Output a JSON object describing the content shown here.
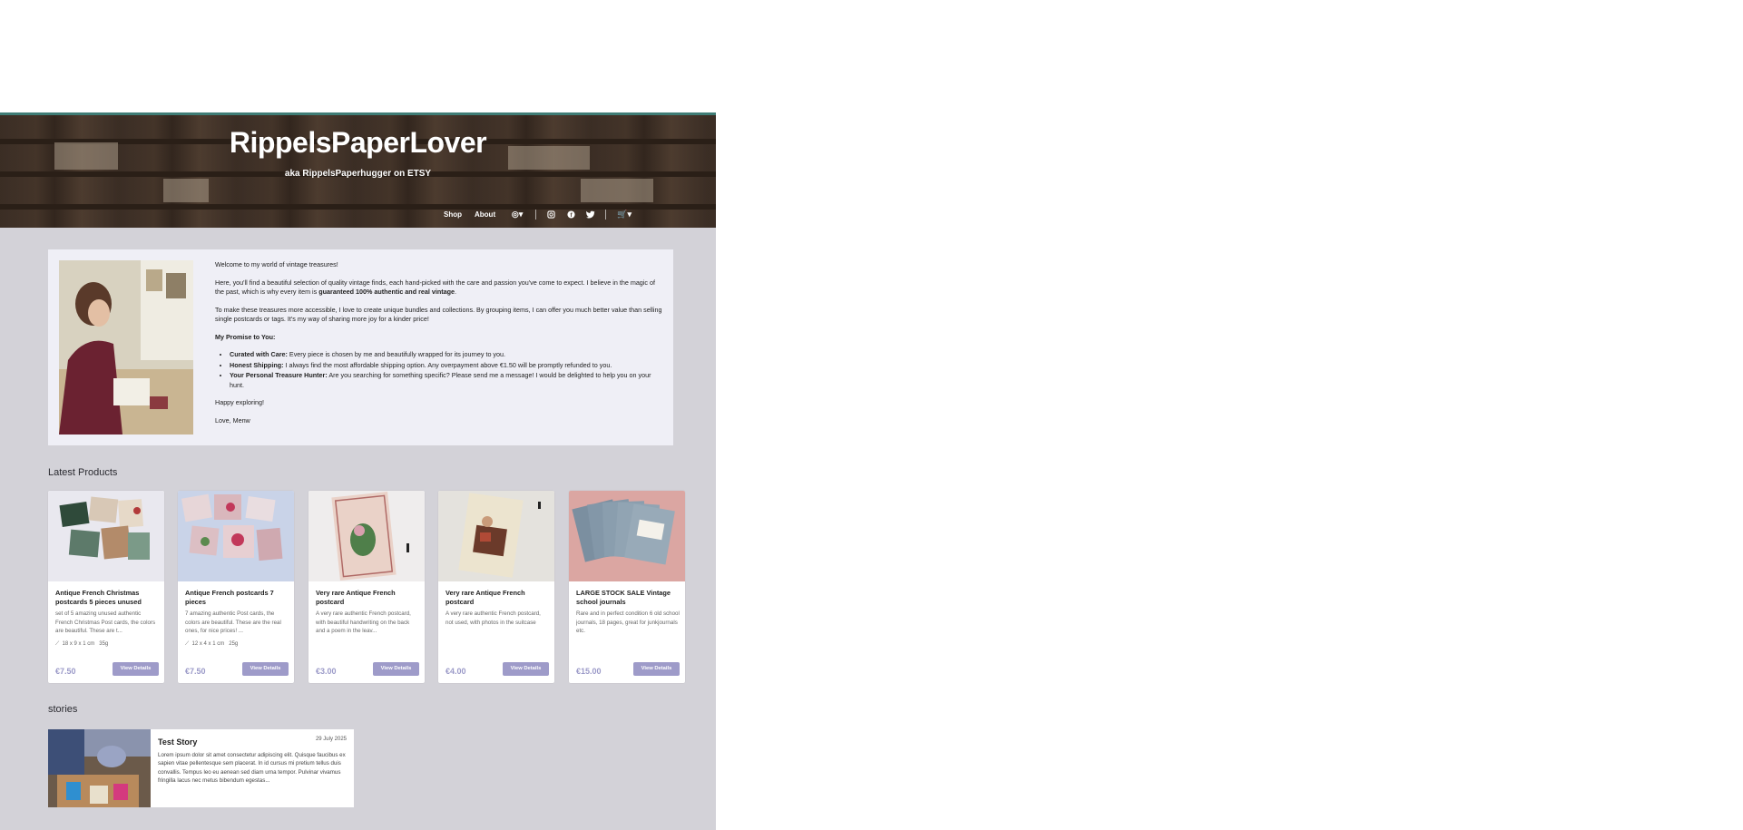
{
  "header": {
    "title": "RippelsPaperLover",
    "subtitle": "aka RippelsPaperhugger on ETSY",
    "nav": {
      "shop": "Shop",
      "about": "About"
    },
    "icons": [
      "language-icon",
      "instagram-icon",
      "facebook-icon",
      "twitter-icon",
      "cart-icon"
    ]
  },
  "intro": {
    "welcome": "Welcome to my world of vintage treasures!",
    "para1_a": "Here, you'll find a beautiful selection of quality vintage finds, each hand-picked with the care and passion you've come to expect. I believe in the magic of the past, which is why every item is ",
    "para1_bold": "guaranteed 100% authentic and real vintage",
    "para1_end": ".",
    "para2": "To make these treasures more accessible, I love to create unique bundles and collections. By grouping items, I can offer you much better value than selling single postcards or tags. It's my way of sharing more joy for a kinder price!",
    "promise_title": "My Promise to You:",
    "promises": [
      {
        "label": "Curated with Care:",
        "text": " Every piece is chosen by me and beautifully wrapped for its journey to you."
      },
      {
        "label": "Honest Shipping:",
        "text": " I always find the most affordable shipping option. Any overpayment above €1.50 will be promptly refunded to you."
      },
      {
        "label": "Your Personal Treasure Hunter:",
        "text": " Are you searching for something specific? Please send me a message! I would be delighted to help you on your hunt."
      }
    ],
    "closing1": "Happy exploring!",
    "closing2": "Love, Menw"
  },
  "latest": {
    "title": "Latest Products",
    "button_label": "View Details",
    "products": [
      {
        "name": "Antique French Christmas postcards 5 pieces unused",
        "desc": "set of 5 amazing unused authentic French Christmas Post cards, the colors are beautiful. These are t...",
        "dims": "18 x 9 x 1 cm",
        "weight": "35g",
        "price": "€7.50"
      },
      {
        "name": "Antique French postcards 7 pieces",
        "desc": "7 amazing authentic Post cards, the colors are beautiful. These are the real ones, for nice prices! ...",
        "dims": "12 x 4 x 1 cm",
        "weight": "25g",
        "price": "€7.50"
      },
      {
        "name": "Very rare Antique French postcard",
        "desc": "A very rare authentic French postcard, with beautiful handwriting on the back and a poem in the leav...",
        "dims": "",
        "weight": "",
        "price": "€3.00"
      },
      {
        "name": "Very rare Antique French postcard",
        "desc": "A very rare authentic French postcard, not used, with photos in the suitcase",
        "dims": "",
        "weight": "",
        "price": "€4.00"
      },
      {
        "name": "LARGE STOCK SALE Vintage school journals",
        "desc": "Rare and in perfect condition 6 old school journals, 18 pages, great for junkjournals etc.",
        "dims": "",
        "weight": "",
        "price": "€15.00"
      }
    ]
  },
  "stories": {
    "title": "stories",
    "item": {
      "title": "Test Story",
      "date": "29 July 2025",
      "body": "Lorem ipsum dolor sit amet consectetur adipiscing elit. Quisque faucibus ex sapien vitae pellentesque sem placerat. In id cursus mi pretium tellus duis convallis. Tempus leo eu aenean sed diam urna tempor. Pulvinar vivamus fringilla lacus nec metus bibendum egestas..."
    }
  }
}
